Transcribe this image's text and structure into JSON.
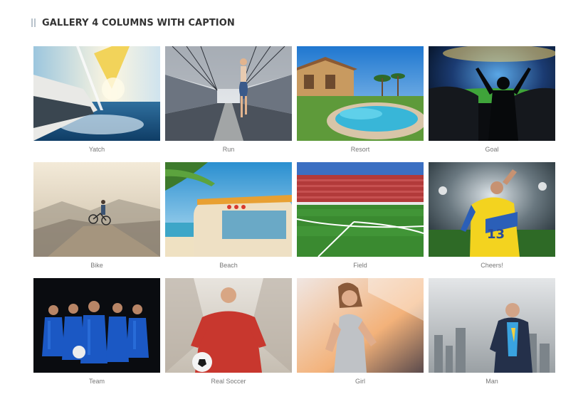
{
  "section": {
    "title": "GALLERY 4 COLUMNS WITH CAPTION"
  },
  "gallery": {
    "items": [
      {
        "caption": "Yatch",
        "scene": "yacht"
      },
      {
        "caption": "Run",
        "scene": "run"
      },
      {
        "caption": "Resort",
        "scene": "resort"
      },
      {
        "caption": "Goal",
        "scene": "goal"
      },
      {
        "caption": "Bike",
        "scene": "bike"
      },
      {
        "caption": "Beach",
        "scene": "beach"
      },
      {
        "caption": "Field",
        "scene": "field"
      },
      {
        "caption": "Cheers!",
        "scene": "cheers"
      },
      {
        "caption": "Team",
        "scene": "team"
      },
      {
        "caption": "Real Soccer",
        "scene": "soccer"
      },
      {
        "caption": "Girl",
        "scene": "girl"
      },
      {
        "caption": "Man",
        "scene": "man"
      }
    ]
  }
}
